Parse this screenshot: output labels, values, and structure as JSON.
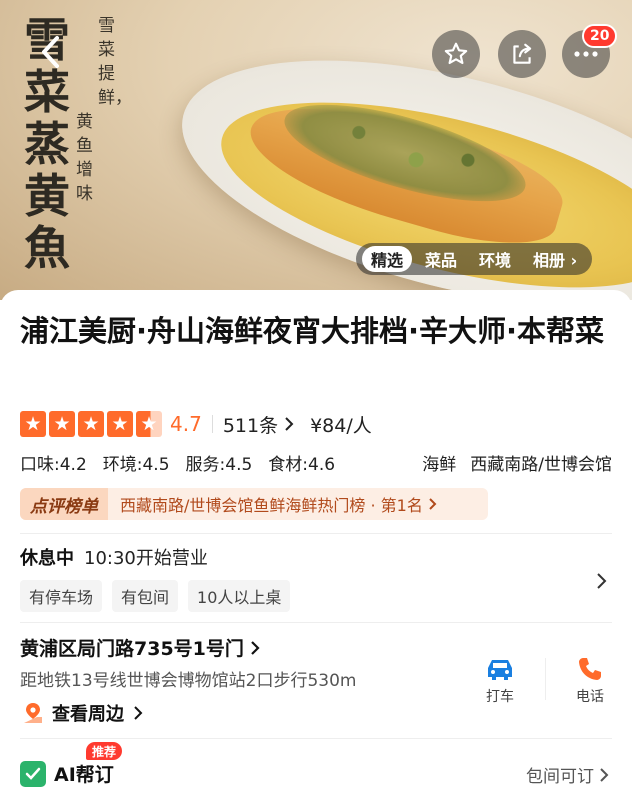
{
  "hero": {
    "calligraphy_title": "雪菜蒸黄魚",
    "calligraphy_sub1": "雪菜提鲜，",
    "calligraphy_sub2": "黄鱼增味",
    "notification_count": "20",
    "photo_tabs": [
      {
        "label": "精选",
        "active": true
      },
      {
        "label": "菜品",
        "active": false
      },
      {
        "label": "环境",
        "active": false
      },
      {
        "label": "相册 ›",
        "active": false
      }
    ]
  },
  "shop": {
    "name": "浦江美厨·舟山海鲜夜宵大排档·辛大师·本帮菜",
    "rating": "4.7",
    "rating_value": 4.7,
    "reviews": "511条",
    "price": "¥84/人",
    "subscores": [
      "口味:4.2",
      "环境:4.5",
      "服务:4.5",
      "食材:4.6"
    ],
    "category": "海鲜",
    "area": "西藏南路/世博会馆"
  },
  "ranking": {
    "label": "点评榜单",
    "text": "西藏南路/世博会馆鱼鲜海鲜热门榜 · 第1名"
  },
  "hours": {
    "status": "休息中",
    "open_time": "10:30开始营业"
  },
  "facilities": [
    "有停车场",
    "有包间",
    "10人以上桌"
  ],
  "address": {
    "street": "黄浦区局门路735号1号门",
    "subway": "距地铁13号线世博会博物馆站2口步行530m",
    "nearby": "查看周边"
  },
  "actions": {
    "taxi": "打车",
    "phone": "电话"
  },
  "booking": {
    "badge": "推荐",
    "ai_label": "AI帮订",
    "room_link": "包间可订"
  },
  "colors": {
    "accent": "#ff6b2b",
    "badge_red": "#ff3a2f",
    "taxi_blue": "#1a7fe0",
    "ai_green": "#2bb36b"
  }
}
